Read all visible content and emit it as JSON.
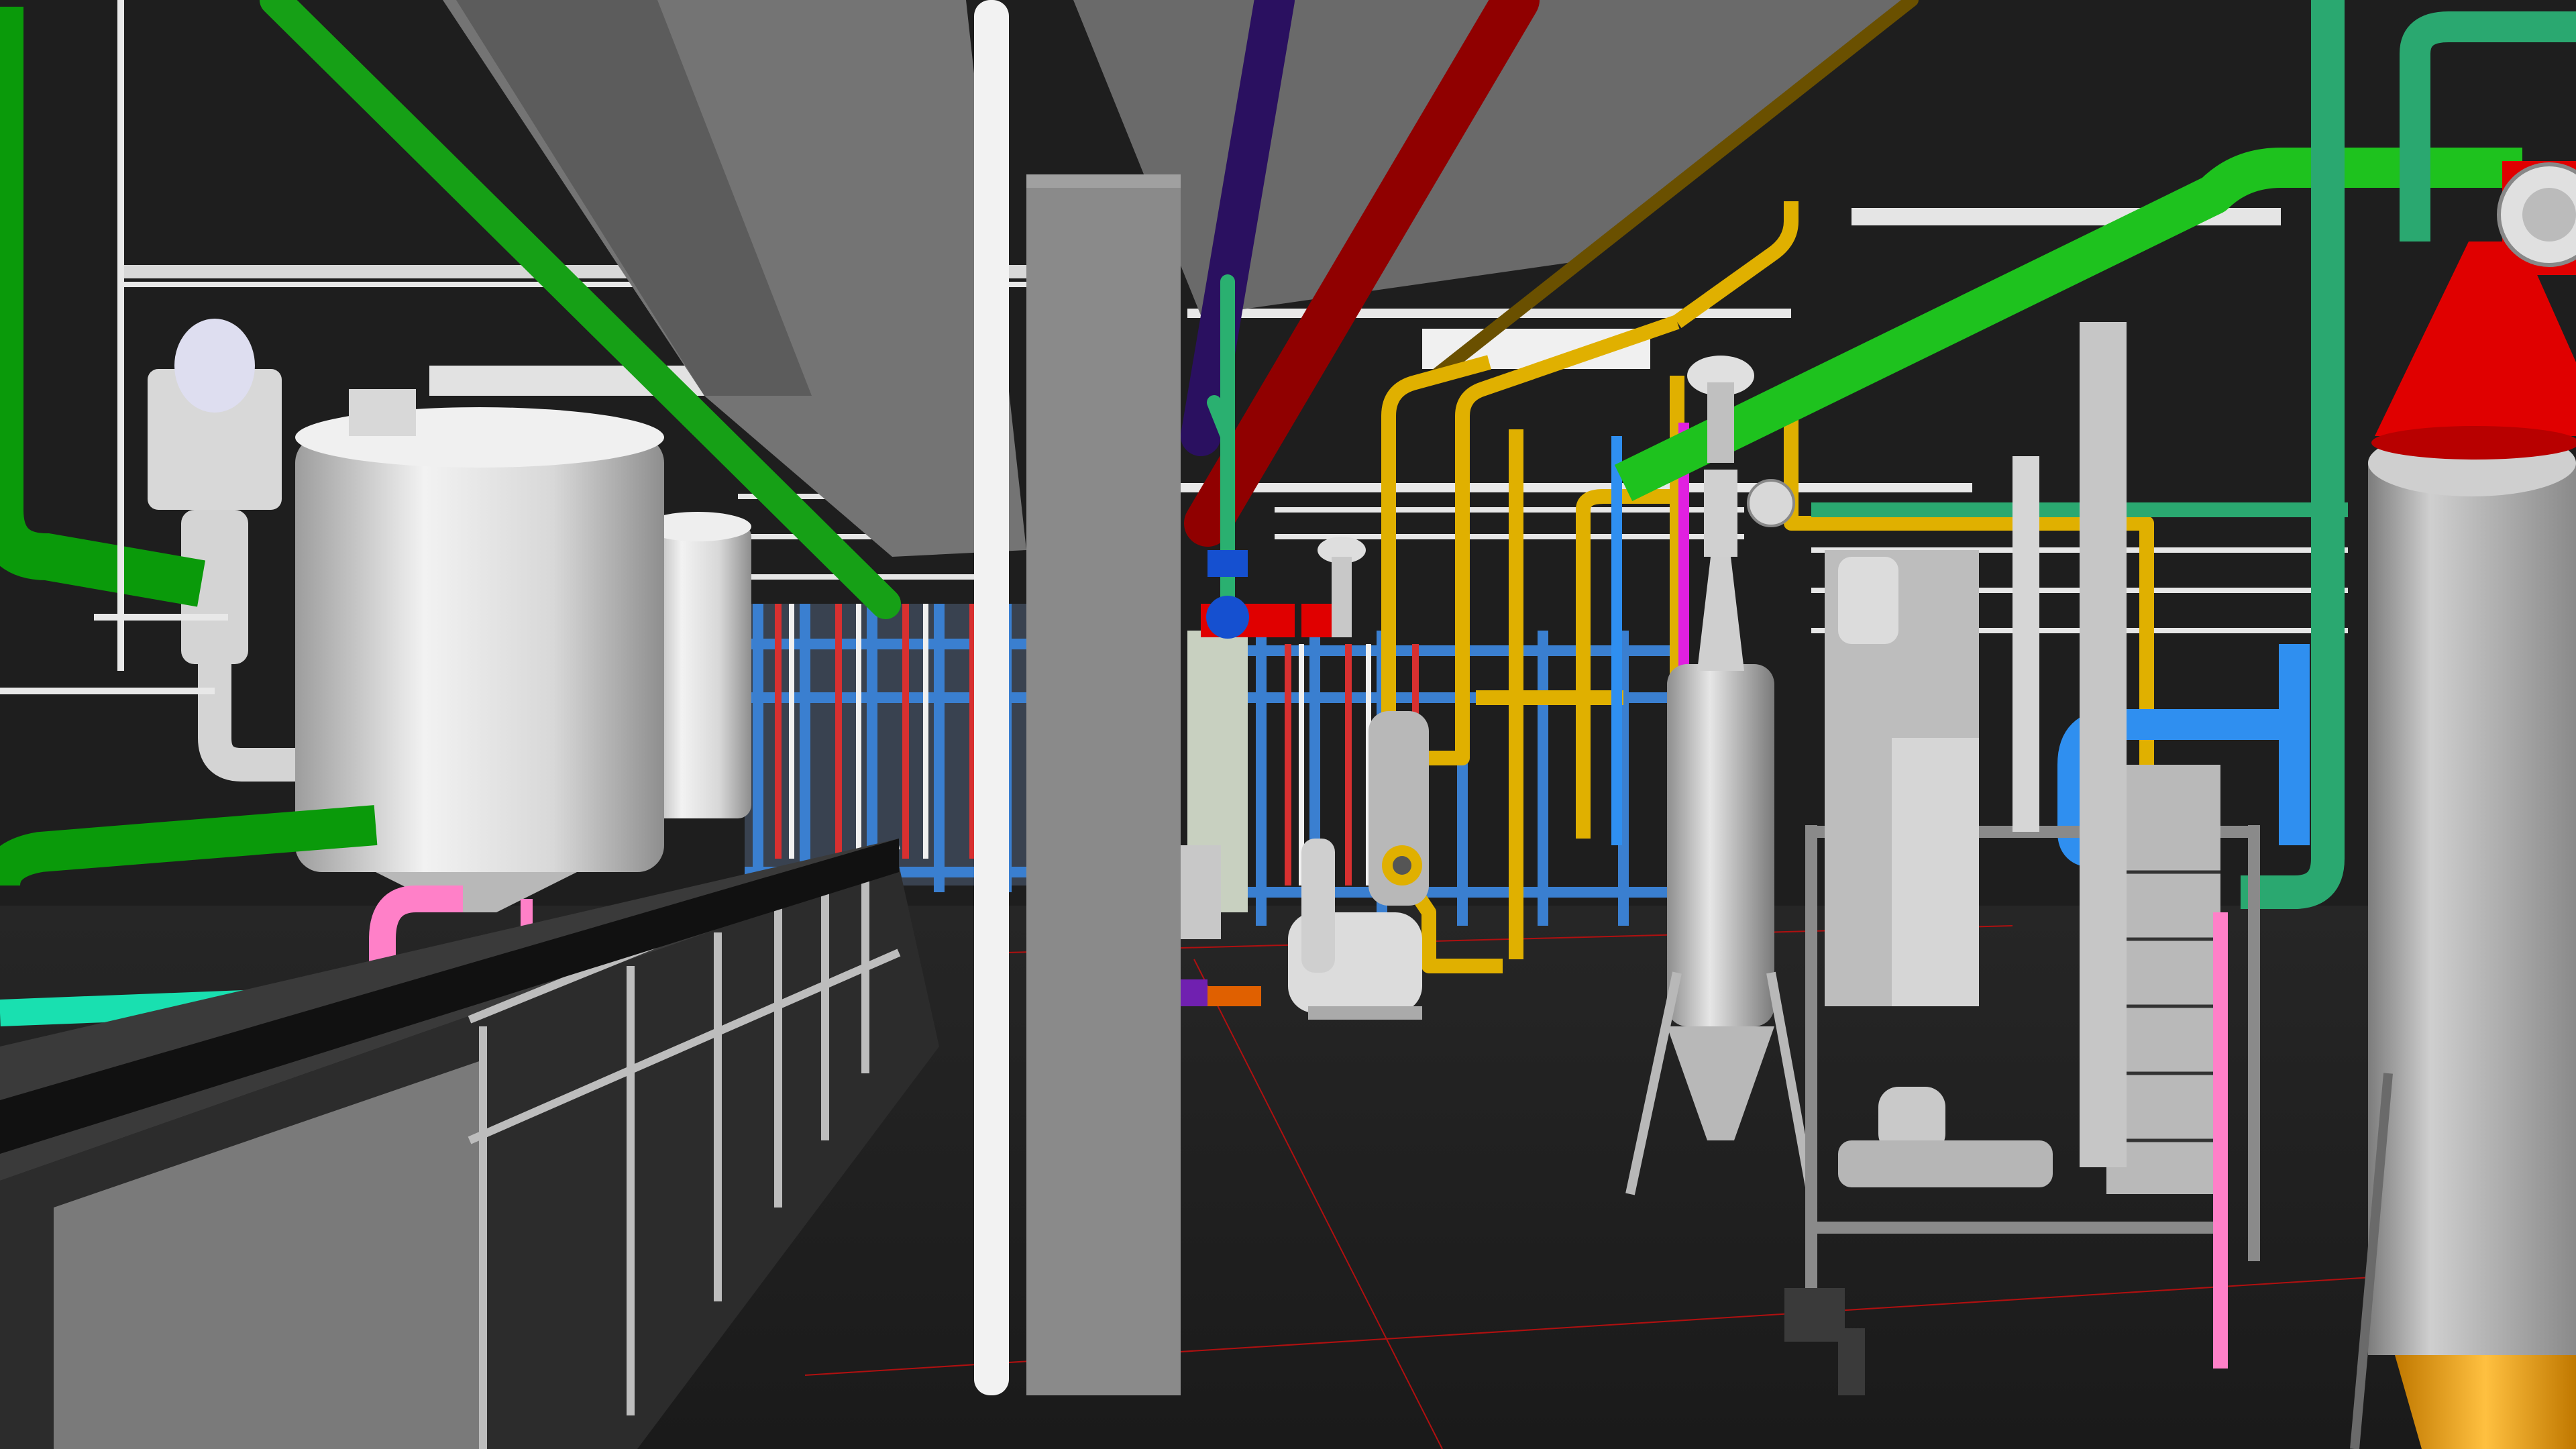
{
  "viewer": {
    "mode": "3d-model-view",
    "background_color": "#1e1e1e",
    "floor_grid_color": "#b01010"
  },
  "palette": {
    "steel": "#cfcfcf",
    "steel_dark": "#9a9a9a",
    "frame_blue": "#3a7fd0",
    "pipe_green": "#1ec21e",
    "pipe_mint": "#2aa870",
    "pipe_teal": "#19e0b0",
    "pipe_red": "#b00000",
    "pipe_yellow": "#e0b000",
    "pipe_pink": "#ff80c8",
    "pipe_magenta": "#e020e0",
    "pipe_sky": "#2f8ff0",
    "valve_blue": "#1550d0",
    "flange_red": "#e00000",
    "duct_gray": "#6e6e6e",
    "cone_orange": "#f0a020"
  },
  "objects": [
    "ceiling-duct",
    "structural-column",
    "storage-tank",
    "handrail",
    "pipe-rack",
    "vertical-vessel",
    "pump-skid",
    "plate-heat-exchanger",
    "control-valve",
    "ventilation-stack",
    "overhead-pipe"
  ]
}
